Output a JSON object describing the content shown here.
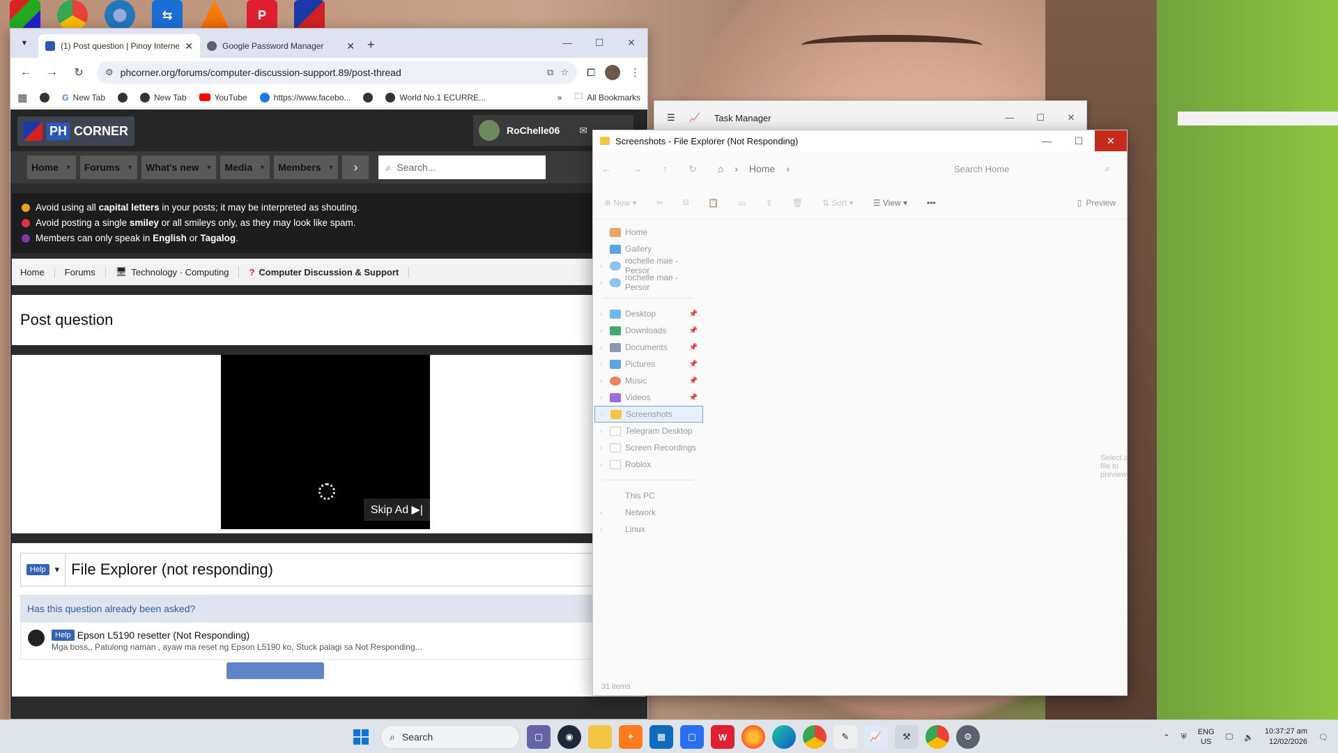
{
  "browser": {
    "tabs": [
      {
        "title": "(1) Post question | Pinoy Interne",
        "active": true,
        "favicon_color": "#2a57b8"
      },
      {
        "title": "Google Password Manager",
        "active": false,
        "favicon_color": "#5f6368"
      }
    ],
    "new_tab_symbol": "+",
    "url": "phcorner.org/forums/computer-discussion-support.89/post-thread",
    "bookmarks": [
      "New Tab",
      "New Tab",
      "YouTube",
      "https://www.facebo...",
      "World No.1 ECURRE..."
    ],
    "all_bookmarks": "All Bookmarks",
    "overflow_symbol": "»"
  },
  "site": {
    "logo_ph": "PH",
    "logo_corner": "CORNER",
    "username": "RoChelle06",
    "nav": [
      "Home",
      "Forums",
      "What's new",
      "Media",
      "Members"
    ],
    "search_placeholder": "Search...",
    "rules": [
      {
        "pre": "Avoid using all ",
        "bold": "capital letters",
        "post": " in your posts; it may be interpreted as shouting.",
        "color": "#f0a020"
      },
      {
        "pre": "Avoid posting a single ",
        "bold": "smiley",
        "post": " or all smileys only, as they may look like spam.",
        "color": "#e0304a"
      },
      {
        "pre": "Members can only speak in ",
        "bold": "English",
        "mid": " or ",
        "bold2": "Tagalog",
        "post": ".",
        "color": "#7a3aa8"
      }
    ],
    "breadcrumbs": [
      "Home",
      "Forums",
      "Technology · Computing",
      "Computer Discussion & Support"
    ],
    "page_title": "Post question",
    "skip_ad": "Skip Ad ▶|",
    "prefix": "Help",
    "thread_title": "File Explorer (not responding)",
    "asked_heading": "Has this question already been asked?",
    "similar": {
      "prefix": "Help",
      "title": "Epson L5190 resetter (Not Responding)",
      "snippet": "Mga boss,, Patulong naman , ayaw ma reset ng Epson L5190 ko, Stuck palagi sa Not Responding..."
    }
  },
  "taskmgr": {
    "title": "Task Manager"
  },
  "explorer": {
    "title": "Screenshots - File Explorer (Not Responding)",
    "address": "Home",
    "search_placeholder": "Search Home",
    "commands": {
      "new": "New",
      "sort": "Sort",
      "view": "View",
      "more": "•••",
      "preview": "Preview"
    },
    "nav_top": [
      {
        "label": "Home",
        "color": "#f2a36b",
        "chev": false
      },
      {
        "label": "Gallery",
        "color": "#5ba3e6",
        "chev": false
      },
      {
        "label": "rochelle mae - Persor",
        "color": "#8ec3f0",
        "chev": true
      },
      {
        "label": "rochelle mae - Persor",
        "color": "#8ec3f0",
        "chev": true
      }
    ],
    "nav_pinned": [
      {
        "label": "Desktop",
        "color": "#6fb8ef"
      },
      {
        "label": "Downloads",
        "color": "#45a86f"
      },
      {
        "label": "Documents",
        "color": "#8c9aad"
      },
      {
        "label": "Pictures",
        "color": "#5ba3e6"
      },
      {
        "label": "Music",
        "color": "#f08060"
      },
      {
        "label": "Videos",
        "color": "#9b6de0"
      }
    ],
    "nav_folders": [
      {
        "label": "Screenshots",
        "color": "#f4c542",
        "selected": true
      },
      {
        "label": "Telegram Desktop",
        "color": "#e8e8e8",
        "selected": false
      },
      {
        "label": "Screen Recordings",
        "color": "#e8e8e8",
        "selected": false
      },
      {
        "label": "Roblox",
        "color": "#e8e8e8",
        "selected": false
      }
    ],
    "nav_bottom": [
      "This PC",
      "Network",
      "Linux"
    ],
    "preview_hint": "Select a file to preview.",
    "status": "31 items"
  },
  "taskbar": {
    "search": "Search",
    "lang_top": "ENG",
    "lang_bottom": "US",
    "time": "10:37:27 am",
    "date": "12/02/2026"
  }
}
